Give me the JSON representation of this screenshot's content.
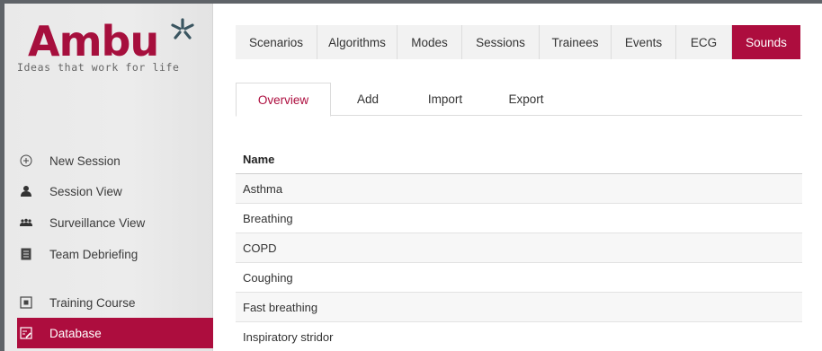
{
  "brand": {
    "logo_text": "Ambu",
    "tagline": "Ideas that work for life",
    "colors": {
      "accent": "#ad0d3e",
      "star": "#3a5560"
    }
  },
  "sidebar": {
    "items": [
      {
        "label": "New Session",
        "icon": "plus-circle-icon"
      },
      {
        "label": "Session View",
        "icon": "person-icon"
      },
      {
        "label": "Surveillance View",
        "icon": "group-icon"
      },
      {
        "label": "Team Debriefing",
        "icon": "document-icon"
      },
      {
        "label": "Training Course",
        "icon": "course-icon"
      },
      {
        "label": "Database",
        "icon": "database-edit-icon",
        "active": true
      }
    ]
  },
  "topnav": {
    "tabs": [
      {
        "label": "Scenarios"
      },
      {
        "label": "Algorithms"
      },
      {
        "label": "Modes"
      },
      {
        "label": "Sessions"
      },
      {
        "label": "Trainees"
      },
      {
        "label": "Events"
      },
      {
        "label": "ECG"
      },
      {
        "label": "Sounds",
        "active": true
      }
    ]
  },
  "subtabs": [
    {
      "label": "Overview",
      "active": true
    },
    {
      "label": "Add"
    },
    {
      "label": "Import"
    },
    {
      "label": "Export"
    }
  ],
  "table": {
    "header": "Name",
    "rows": [
      "Asthma",
      "Breathing",
      "COPD",
      "Coughing",
      "Fast breathing",
      "Inspiratory stridor"
    ]
  }
}
